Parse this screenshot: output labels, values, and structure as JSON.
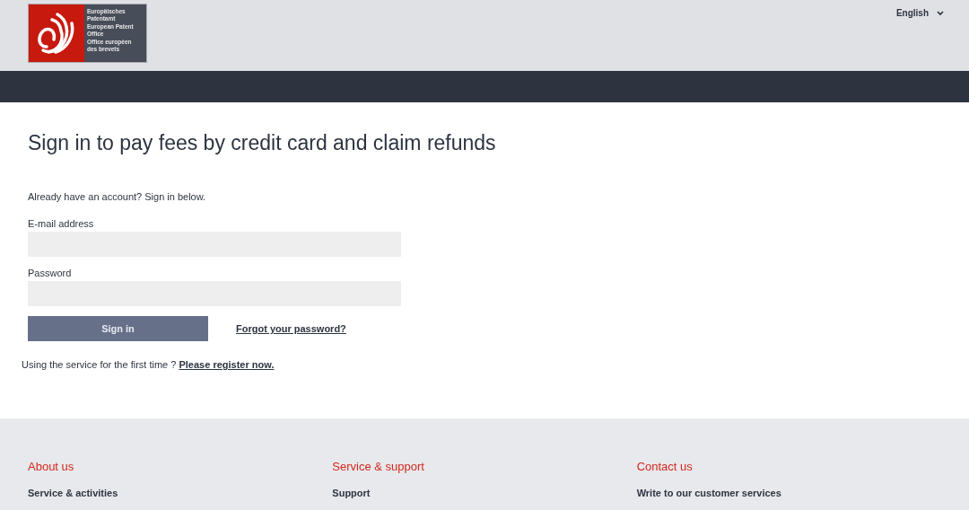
{
  "header": {
    "logo_text": [
      "Europäisches Patentamt",
      "European Patent Office",
      "Office européen des brevets"
    ],
    "language": "English"
  },
  "main": {
    "title": "Sign in to pay fees by credit card and claim refunds",
    "intro": "Already have an account? Sign in below.",
    "fields": [
      {
        "label": "E-mail address"
      },
      {
        "label": "Password"
      }
    ],
    "sign_in_button": "Sign in",
    "forgot_link": "Forgot your password?",
    "register_text": "Using the service for the first time ?",
    "register_link": "Please register now."
  },
  "footer": {
    "columns": [
      {
        "heading": "About us",
        "link": "Service & activities"
      },
      {
        "heading": "Service & support",
        "link": "Support"
      },
      {
        "heading": "Contact us",
        "link": "Write to our customer services"
      }
    ]
  }
}
